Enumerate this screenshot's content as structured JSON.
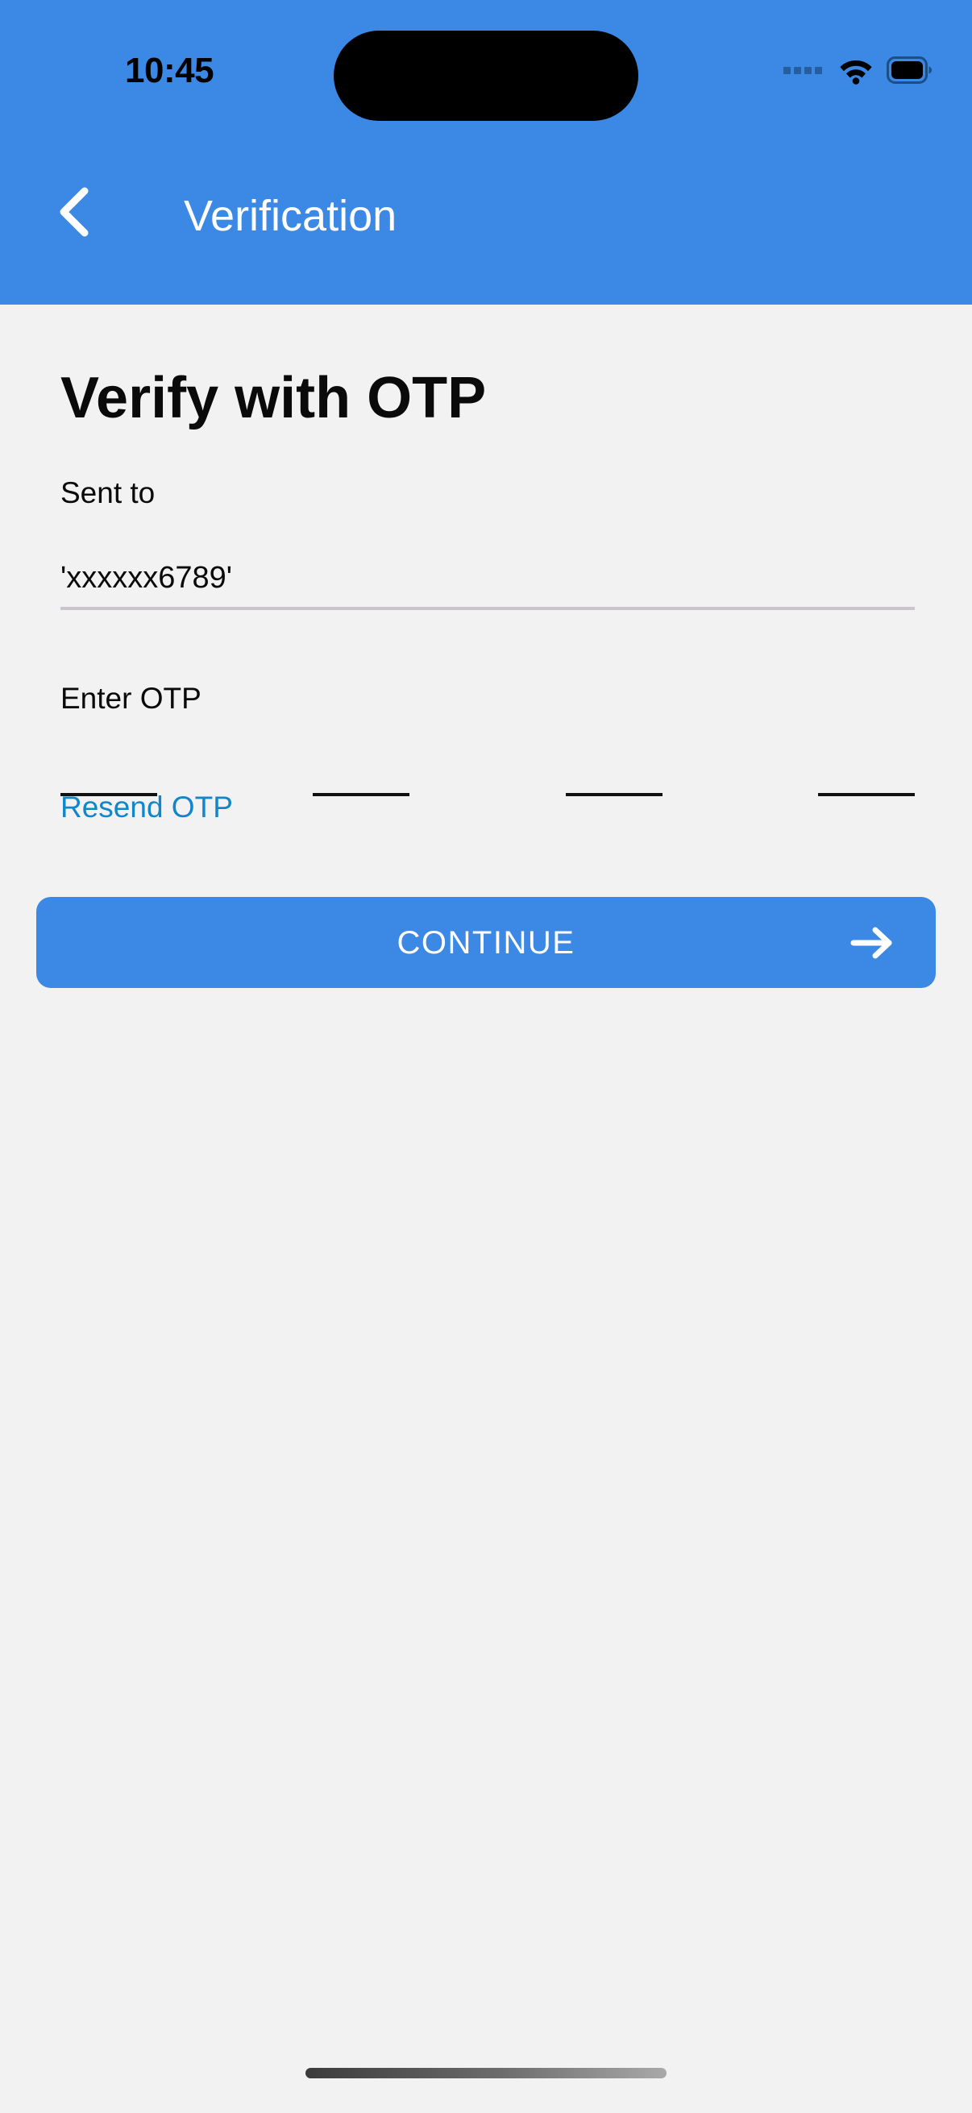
{
  "status_bar": {
    "time": "10:45",
    "icons": {
      "signal": "signal-dots-icon",
      "wifi": "wifi-icon",
      "battery": "battery-full-icon"
    }
  },
  "app_bar": {
    "back_icon": "chevron-left-icon",
    "title": "Verification"
  },
  "main": {
    "page_title": "Verify with OTP",
    "sent_to_label": "Sent to",
    "phone_value": "'xxxxxx6789'",
    "enter_otp_label": "Enter OTP",
    "otp_digits": [
      "",
      "",
      "",
      ""
    ],
    "resend_label": "Resend OTP",
    "continue_label": "CONTINUE",
    "continue_arrow_icon": "arrow-right-icon"
  },
  "colors": {
    "brand_blue": "#3B88E5",
    "link_blue": "#1186CA",
    "background": "#F2F2F2",
    "otp_underline": "#111111",
    "field_underline": "#C8C5CE",
    "text_primary": "#0A0A0A",
    "on_brand": "#FFFFFF"
  }
}
